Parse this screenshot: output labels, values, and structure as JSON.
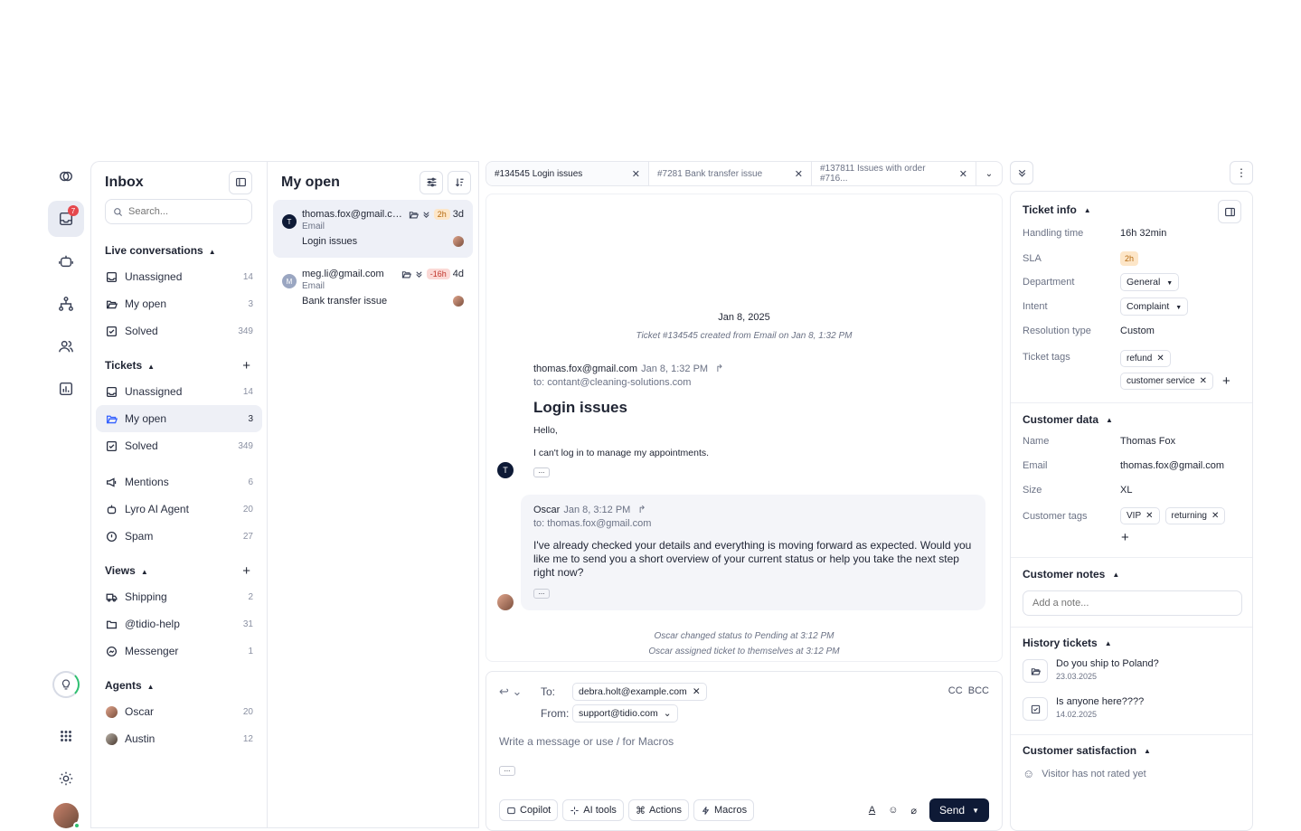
{
  "colors": {
    "accent": "#0e1a36",
    "badge_red": "#e5484d",
    "sla_orange_bg": "#fde6c8",
    "sla_red_bg": "#fbd9d6"
  },
  "rail": {
    "badge_count": "7"
  },
  "inbox": {
    "title": "Inbox",
    "search_placeholder": "Search...",
    "live": {
      "title": "Live conversations",
      "items": [
        {
          "label": "Unassigned",
          "count": "14"
        },
        {
          "label": "My open",
          "count": "3"
        },
        {
          "label": "Solved",
          "count": "349"
        }
      ]
    },
    "tickets": {
      "title": "Tickets",
      "items": [
        {
          "label": "Unassigned",
          "count": "14"
        },
        {
          "label": "My open",
          "count": "3"
        },
        {
          "label": "Solved",
          "count": "349"
        }
      ]
    },
    "other": [
      {
        "label": "Mentions",
        "count": "6"
      },
      {
        "label": "Lyro AI Agent",
        "count": "20"
      },
      {
        "label": "Spam",
        "count": "27"
      }
    ],
    "views": {
      "title": "Views",
      "items": [
        {
          "label": "Shipping",
          "count": "2"
        },
        {
          "label": "@tidio-help",
          "count": "31"
        },
        {
          "label": "Messenger",
          "count": "1"
        }
      ]
    },
    "agents": {
      "title": "Agents",
      "items": [
        {
          "label": "Oscar",
          "count": "20"
        },
        {
          "label": "Austin",
          "count": "12"
        }
      ]
    }
  },
  "convs": {
    "title": "My open",
    "items": [
      {
        "initial": "T",
        "email": "thomas.fox@gmail.com",
        "sla": "2h",
        "age": "3d",
        "channel": "Email",
        "subject": "Login issues"
      },
      {
        "initial": "M",
        "email": "meg.li@gmail.com",
        "sla": "-16h",
        "age": "4d",
        "channel": "Email",
        "subject": "Bank transfer issue"
      }
    ]
  },
  "tabs": [
    {
      "label": "#134545 Login issues"
    },
    {
      "label": "#7281 Bank transfer issue"
    },
    {
      "label": "#137811 Issues with order #716..."
    }
  ],
  "thread": {
    "date": "Jan 8, 2025",
    "created": "Ticket #134545 created from Email on Jan 8, 1:32 PM",
    "m1": {
      "from": "thomas.fox@gmail.com",
      "time": "Jan 8, 1:32 PM",
      "to": "to: contant@cleaning-solutions.com",
      "subject": "Login issues",
      "greeting": "Hello,",
      "body": "I can't log in to manage my appointments."
    },
    "m2": {
      "from": "Oscar",
      "time": "Jan 8, 3:12 PM",
      "to": "to: thomas.fox@gmail.com",
      "body": "I've already checked your details and everything is moving forward as expected. Would you like me to send you a short overview of your current status or help you take the next step right now?"
    },
    "status1": "Oscar changed status to Pending at 3:12 PM",
    "status2": "Oscar assigned ticket to themselves at 3:12 PM"
  },
  "composer": {
    "to_label": "To:",
    "to_value": "debra.holt@example.com",
    "from_label": "From:",
    "from_value": "support@tidio.com",
    "cc": "CC",
    "bcc": "BCC",
    "placeholder": "Write a message or use / for Macros",
    "tools": [
      "Copilot",
      "AI tools",
      "Actions",
      "Macros"
    ],
    "send": "Send"
  },
  "details": {
    "ticket_info": "Ticket info",
    "handling_time_label": "Handling time",
    "handling_time": "16h 32min",
    "sla_label": "SLA",
    "sla": "2h",
    "department_label": "Department",
    "department": "General",
    "intent_label": "Intent",
    "intent": "Complaint",
    "resolution_label": "Resolution type",
    "resolution": "Custom",
    "ticket_tags_label": "Ticket tags",
    "ticket_tags": [
      "refund",
      "customer service"
    ],
    "customer_data": "Customer data",
    "name_label": "Name",
    "name": "Thomas Fox",
    "email_label": "Email",
    "email": "thomas.fox@gmail.com",
    "size_label": "Size",
    "size": "XL",
    "customer_tags_label": "Customer tags",
    "customer_tags": [
      "VIP",
      "returning"
    ],
    "customer_notes": "Customer notes",
    "note_placeholder": "Add a note...",
    "history": "History tickets",
    "history_items": [
      {
        "title": "Do you ship to Poland?",
        "date": "23.03.2025"
      },
      {
        "title": "Is anyone here????",
        "date": "14.02.2025"
      }
    ],
    "satisfaction": "Customer satisfaction",
    "satisfaction_text": "Visitor has not rated yet"
  }
}
